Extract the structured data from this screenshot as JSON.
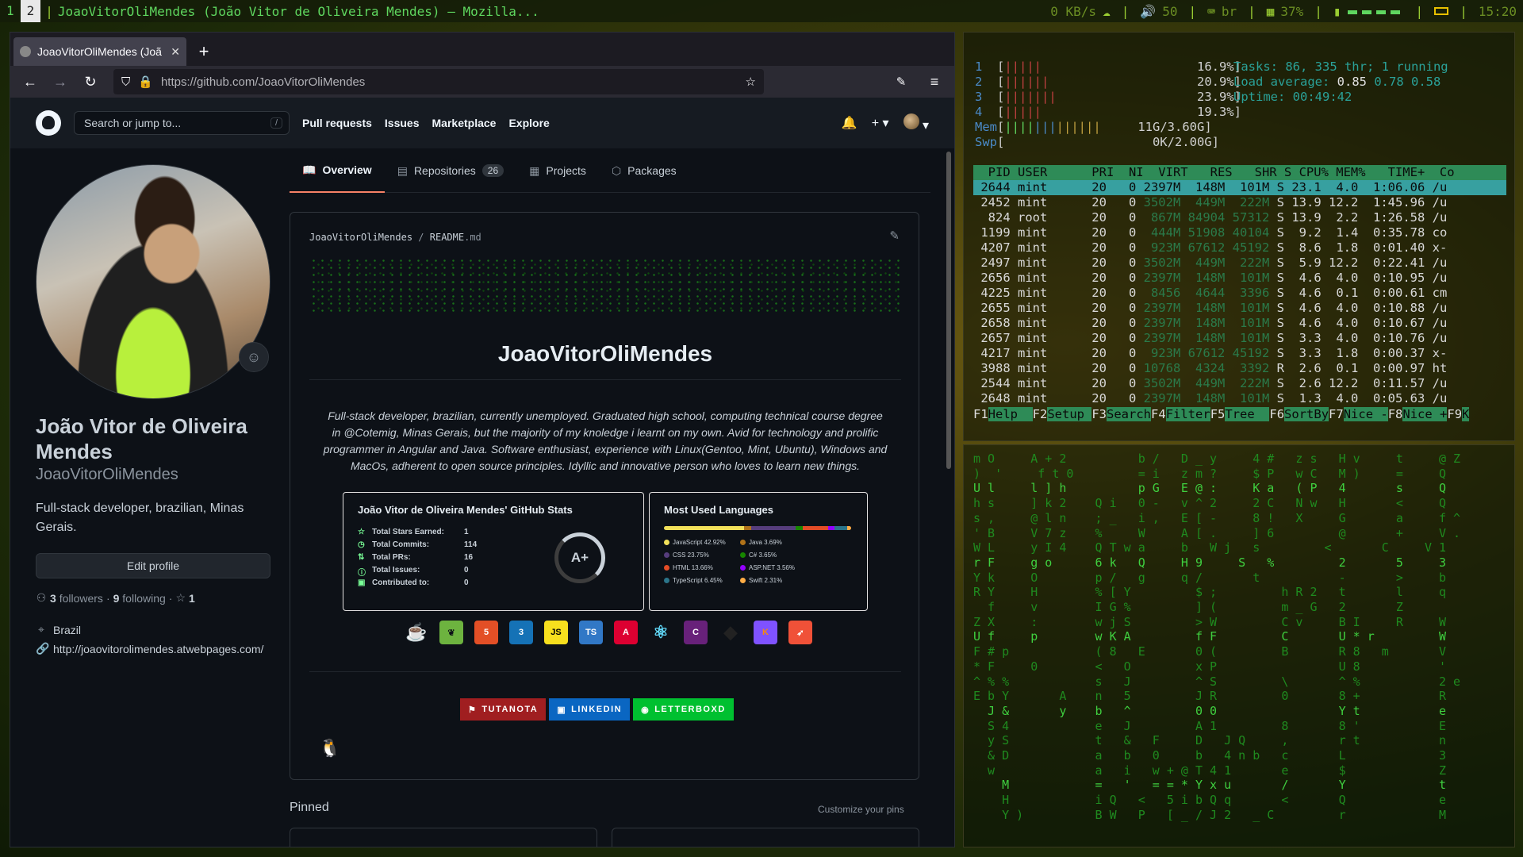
{
  "topbar": {
    "workspaces": [
      "1",
      "2"
    ],
    "active_workspace": "2",
    "window_title": "JoaoVitorOliMendes (João Vitor de Oliveira Mendes) — Mozilla...",
    "net_speed": "0 KB/s",
    "volume": "50",
    "keyboard": "br",
    "battery_or_mem": "37%",
    "clock": "15:20"
  },
  "browser": {
    "tab_title": "JoaoVitorOliMendes (Joã",
    "url": "https://github.com/JoaoVitorOliMendes"
  },
  "github": {
    "search_placeholder": "Search or jump to...",
    "search_shortcut": "/",
    "nav": [
      "Pull requests",
      "Issues",
      "Marketplace",
      "Explore"
    ],
    "profile": {
      "full_name": "João Vitor de Oliveira Mendes",
      "username": "JoaoVitorOliMendes",
      "bio": "Full-stack developer, brazilian, Minas Gerais.",
      "edit_profile": "Edit profile",
      "followers_count": "3",
      "followers_label": "followers",
      "following_count": "9",
      "following_label": "following",
      "stars_count": "1",
      "location": "Brazil",
      "website": "http://joaovitorolimendes.atwebpages.com/"
    },
    "tabs": [
      {
        "label": "Overview",
        "icon": "book-icon"
      },
      {
        "label": "Repositories",
        "icon": "repo-icon",
        "count": "26"
      },
      {
        "label": "Projects",
        "icon": "table-icon"
      },
      {
        "label": "Packages",
        "icon": "package-icon"
      }
    ],
    "readme": {
      "path_user": "JoaoVitorOliMendes",
      "path_sep": "/",
      "path_file": "README",
      "path_ext": ".md",
      "title": "JoaoVitorOliMendes",
      "description": "Full-stack developer, brazilian, currently unemployed. Graduated high school, computing technical course degree in @Cotemig, Minas Gerais, but the majority of my knoledge i learnt on my own. Avid for technology and prolific programmer in Angular and Java. Software enthusiast, experience with Linux(Gentoo, Mint, Ubuntu), Windows and MacOs, adherent to open source principles. Idyllic and innovative person who loves to learn new things.",
      "stats_card": {
        "title": "João Vitor de Oliveira Mendes' GitHub Stats",
        "rows": [
          {
            "label": "Total Stars Earned:",
            "value": "1",
            "icon": "star-icon"
          },
          {
            "label": "Total Commits:",
            "value": "114",
            "icon": "history-icon"
          },
          {
            "label": "Total PRs:",
            "value": "16",
            "icon": "pr-icon"
          },
          {
            "label": "Total Issues:",
            "value": "0",
            "icon": "issue-icon"
          },
          {
            "label": "Contributed to:",
            "value": "0",
            "icon": "repo-icon"
          }
        ],
        "grade": "A+"
      },
      "languages_card": {
        "title": "Most Used Languages",
        "languages": [
          {
            "name": "JavaScript",
            "pct": "42.92%",
            "value": 42.92,
            "color": "#f1e05a"
          },
          {
            "name": "Java",
            "pct": "3.69%",
            "value": 3.69,
            "color": "#b07219"
          },
          {
            "name": "CSS",
            "pct": "23.75%",
            "value": 23.75,
            "color": "#563d7c"
          },
          {
            "name": "C#",
            "pct": "3.65%",
            "value": 3.65,
            "color": "#178600"
          },
          {
            "name": "HTML",
            "pct": "13.66%",
            "value": 13.66,
            "color": "#e34c26"
          },
          {
            "name": "ASP.NET",
            "pct": "3.56%",
            "value": 3.56,
            "color": "#9400ff"
          },
          {
            "name": "TypeScript",
            "pct": "6.45%",
            "value": 6.45,
            "color": "#2b7489"
          },
          {
            "name": "Swift",
            "pct": "2.31%",
            "value": 2.31,
            "color": "#ffac45"
          }
        ]
      },
      "tech_icons": [
        {
          "name": "java-icon",
          "glyph": "☕",
          "bg": "transparent",
          "fg": "#e76f00"
        },
        {
          "name": "spring-icon",
          "glyph": "❦",
          "bg": "#6db33f",
          "fg": "#0d1117"
        },
        {
          "name": "html5-icon",
          "glyph": "5",
          "bg": "#e34f26",
          "fg": "#ffffff"
        },
        {
          "name": "css3-icon",
          "glyph": "3",
          "bg": "#1572b6",
          "fg": "#ffffff"
        },
        {
          "name": "javascript-icon",
          "glyph": "JS",
          "bg": "#f7df1e",
          "fg": "#000000"
        },
        {
          "name": "typescript-icon",
          "glyph": "TS",
          "bg": "#3178c6",
          "fg": "#ffffff"
        },
        {
          "name": "angular-icon",
          "glyph": "A",
          "bg": "#dd0031",
          "fg": "#ffffff"
        },
        {
          "name": "react-icon",
          "glyph": "⚛",
          "bg": "transparent",
          "fg": "#61dafb"
        },
        {
          "name": "csharp-icon",
          "glyph": "C",
          "bg": "#68217a",
          "fg": "#ffffff"
        },
        {
          "name": "unity-icon",
          "glyph": "◆",
          "bg": "transparent",
          "fg": "#222222"
        },
        {
          "name": "kotlin-icon",
          "glyph": "K",
          "bg": "#7f52ff",
          "fg": "#f88909"
        },
        {
          "name": "swift-icon",
          "glyph": "➶",
          "bg": "#f05138",
          "fg": "#ffffff"
        }
      ],
      "badges": [
        {
          "label": "TUTANOTA",
          "bg": "#a01e20",
          "icon": "tutanota-icon"
        },
        {
          "label": "LINKEDIN",
          "bg": "#0a66c2",
          "icon": "linkedin-icon"
        },
        {
          "label": "LETTERBOXD",
          "bg": "#00c030",
          "icon": "letterboxd-icon"
        }
      ]
    },
    "pinned_label": "Pinned",
    "customize_pins": "Customize your pins"
  },
  "htop": {
    "cpus": [
      {
        "id": "1",
        "pct": "16.9%]"
      },
      {
        "id": "2",
        "pct": "20.9%]"
      },
      {
        "id": "3",
        "pct": "23.9%]"
      },
      {
        "id": "4",
        "pct": "19.3%]"
      }
    ],
    "mem": "11G/3.60G]",
    "swp": "0K/2.00G]",
    "tasks": "Tasks: 86, 335 thr; 1 running",
    "load_label": "Load average:",
    "load_1": "0.85",
    "load_rest": "0.78 0.58",
    "uptime": "Uptime: 00:49:42",
    "header": "  PID USER      PRI  NI  VIRT   RES   SHR S CPU% MEM%   TIME+  Co",
    "rows": [
      {
        "pid": "2644",
        "user": "mint",
        "pri": "20",
        "ni": "0",
        "virt": "2397M",
        "res": "148M",
        "shr": "101M",
        "s": "S",
        "cpu": "23.1",
        "mem": "4.0",
        "time": "1:06.06",
        "cmd": "/u",
        "selected": true
      },
      {
        "pid": "2452",
        "user": "mint",
        "pri": "20",
        "ni": "0",
        "virt": "3502M",
        "res": "449M",
        "shr": "222M",
        "s": "S",
        "cpu": "13.9",
        "mem": "12.2",
        "time": "1:45.96",
        "cmd": "/u"
      },
      {
        "pid": "824",
        "user": "root",
        "pri": "20",
        "ni": "0",
        "virt": "867M",
        "res": "84904",
        "shr": "57312",
        "s": "S",
        "cpu": "13.9",
        "mem": "2.2",
        "time": "1:26.58",
        "cmd": "/u"
      },
      {
        "pid": "1199",
        "user": "mint",
        "pri": "20",
        "ni": "0",
        "virt": "444M",
        "res": "51908",
        "shr": "40104",
        "s": "S",
        "cpu": "9.2",
        "mem": "1.4",
        "time": "0:35.78",
        "cmd": "co"
      },
      {
        "pid": "4207",
        "user": "mint",
        "pri": "20",
        "ni": "0",
        "virt": "923M",
        "res": "67612",
        "shr": "45192",
        "s": "S",
        "cpu": "8.6",
        "mem": "1.8",
        "time": "0:01.40",
        "cmd": "x-"
      },
      {
        "pid": "2497",
        "user": "mint",
        "pri": "20",
        "ni": "0",
        "virt": "3502M",
        "res": "449M",
        "shr": "222M",
        "s": "S",
        "cpu": "5.9",
        "mem": "12.2",
        "time": "0:22.41",
        "cmd": "/u"
      },
      {
        "pid": "2656",
        "user": "mint",
        "pri": "20",
        "ni": "0",
        "virt": "2397M",
        "res": "148M",
        "shr": "101M",
        "s": "S",
        "cpu": "4.6",
        "mem": "4.0",
        "time": "0:10.95",
        "cmd": "/u"
      },
      {
        "pid": "4225",
        "user": "mint",
        "pri": "20",
        "ni": "0",
        "virt": "8456",
        "res": "4644",
        "shr": "3396",
        "s": "S",
        "cpu": "4.6",
        "mem": "0.1",
        "time": "0:00.61",
        "cmd": "cm"
      },
      {
        "pid": "2655",
        "user": "mint",
        "pri": "20",
        "ni": "0",
        "virt": "2397M",
        "res": "148M",
        "shr": "101M",
        "s": "S",
        "cpu": "4.6",
        "mem": "4.0",
        "time": "0:10.88",
        "cmd": "/u"
      },
      {
        "pid": "2658",
        "user": "mint",
        "pri": "20",
        "ni": "0",
        "virt": "2397M",
        "res": "148M",
        "shr": "101M",
        "s": "S",
        "cpu": "4.6",
        "mem": "4.0",
        "time": "0:10.67",
        "cmd": "/u"
      },
      {
        "pid": "2657",
        "user": "mint",
        "pri": "20",
        "ni": "0",
        "virt": "2397M",
        "res": "148M",
        "shr": "101M",
        "s": "S",
        "cpu": "3.3",
        "mem": "4.0",
        "time": "0:10.76",
        "cmd": "/u"
      },
      {
        "pid": "4217",
        "user": "mint",
        "pri": "20",
        "ni": "0",
        "virt": "923M",
        "res": "67612",
        "shr": "45192",
        "s": "S",
        "cpu": "3.3",
        "mem": "1.8",
        "time": "0:00.37",
        "cmd": "x-"
      },
      {
        "pid": "3988",
        "user": "mint",
        "pri": "20",
        "ni": "0",
        "virt": "10768",
        "res": "4324",
        "shr": "3392",
        "s": "R",
        "cpu": "2.6",
        "mem": "0.1",
        "time": "0:00.97",
        "cmd": "ht"
      },
      {
        "pid": "2544",
        "user": "mint",
        "pri": "20",
        "ni": "0",
        "virt": "3502M",
        "res": "449M",
        "shr": "222M",
        "s": "S",
        "cpu": "2.6",
        "mem": "12.2",
        "time": "0:11.57",
        "cmd": "/u"
      },
      {
        "pid": "2648",
        "user": "mint",
        "pri": "20",
        "ni": "0",
        "virt": "2397M",
        "res": "148M",
        "shr": "101M",
        "s": "S",
        "cpu": "1.3",
        "mem": "4.0",
        "time": "0:05.63",
        "cmd": "/u"
      }
    ],
    "fkeys": [
      {
        "key": "F1",
        "label": "Help  "
      },
      {
        "key": "F2",
        "label": "Setup "
      },
      {
        "key": "F3",
        "label": "Search"
      },
      {
        "key": "F4",
        "label": "Filter"
      },
      {
        "key": "F5",
        "label": "Tree  "
      },
      {
        "key": "F6",
        "label": "SortBy"
      },
      {
        "key": "F7",
        "label": "Nice -"
      },
      {
        "key": "F8",
        "label": "Nice +"
      },
      {
        "key": "F9",
        "label": "K"
      }
    ]
  },
  "matrix_lines": [
    "m O     A + 2          b /   D _ y     4 #   z s   H v     t     @ Z",
    ")  '     f t 0         = i   z m ?     $ P   w C   M )     =     Q",
    "U l     l ] h          p G   E @ :     K a   ( P   4       s     Q",
    "h s     ] k 2    Q i   0 -   v ^ 2     2 C   N w   H       <     Q",
    "s ,     @ l n    ; _   i ,   E [ -     8 !   X     G       a     f ^",
    "' B     V 7 z    %     W     A [ .     ] 6         @       +     V .",
    "W L     y I 4    Q T w a     b   W j   s         <       C     V 1",
    "r F     g o      6 k   Q     H 9     S   %         2       5     3",
    "Y k     O        p /   g     q /       t           -       >     b",
    "R Y     H        % [ Y         $ ;         h R 2   t       l     q",
    "  f     v        I G %         ] (         m _ G   2       Z",
    "Z X     :        w j S         > W         C v     B I     R     W",
    "U f     p        w K A         f F         C       U * r         W",
    "F # p            ( 8   E       0 (         B       R 8   m       V",
    "* F     0        <   O         x P                 U 8           '",
    "^ % %            s   J         ^ S         \\       ^ %           2 e",
    "E b Y       A    n   5         J R         0       8 +           R",
    "  J &       y    b   ^         0 0                 Y t           e",
    "  S 4            e   J         A 1         8       8 '           E",
    "  y S            t   &   F     D   J Q     ,       r t           n",
    "  & D            a   b   0     b   4 n b   c       L             3",
    "  w              a   i   w + @ T 4 1       e       $             Z",
    "    M            =   '   = = * Y x u       /       Y             t",
    "    H            i Q   <   5 i b Q q       <       Q             e",
    "    Y )          B W   P   [ _ / J 2   _ C         r             M"
  ]
}
